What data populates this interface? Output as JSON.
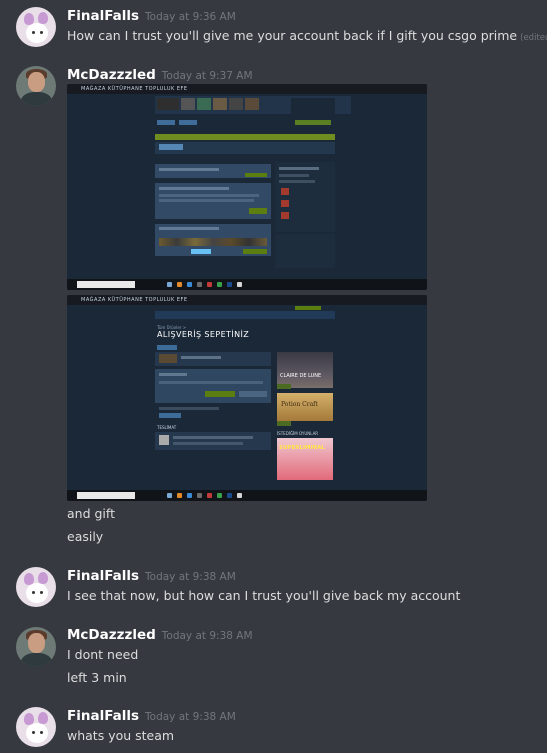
{
  "messages": [
    {
      "username": "FinalFalls",
      "timestamp": "Today at 9:36 AM",
      "lines": [
        "How can I trust you'll give me your account back if I gift you csgo prime"
      ],
      "edited": "(edited)"
    },
    {
      "username": "McDazzzled",
      "timestamp": "Today at 9:37 AM",
      "screenshot1": {
        "nav": "MAĞAZA   KÜTÜPHANE   TOPLULUK   EFE"
      },
      "screenshot2": {
        "nav": "MAĞAZA   KÜTÜPHANE   TOPLULUK   EFE",
        "heading": "ALIŞVERİŞ SEPETİNİZ",
        "sidebar_label": "İSTEDİĞİM OYUNLAR",
        "game1": "CLAIRE DE LUNE",
        "game2": "Potion Craft",
        "game3": "SUPERLIMINAL"
      },
      "lines": [
        "and gift",
        "easily"
      ]
    },
    {
      "username": "FinalFalls",
      "timestamp": "Today at 9:38 AM",
      "lines": [
        "I see that now, but how can I trust you'll give back my account"
      ]
    },
    {
      "username": "McDazzzled",
      "timestamp": "Today at 9:38 AM",
      "lines": [
        "I dont need",
        "left 3 min"
      ]
    },
    {
      "username": "FinalFalls",
      "timestamp": "Today at 9:38 AM",
      "lines": [
        "whats you steam"
      ]
    }
  ]
}
